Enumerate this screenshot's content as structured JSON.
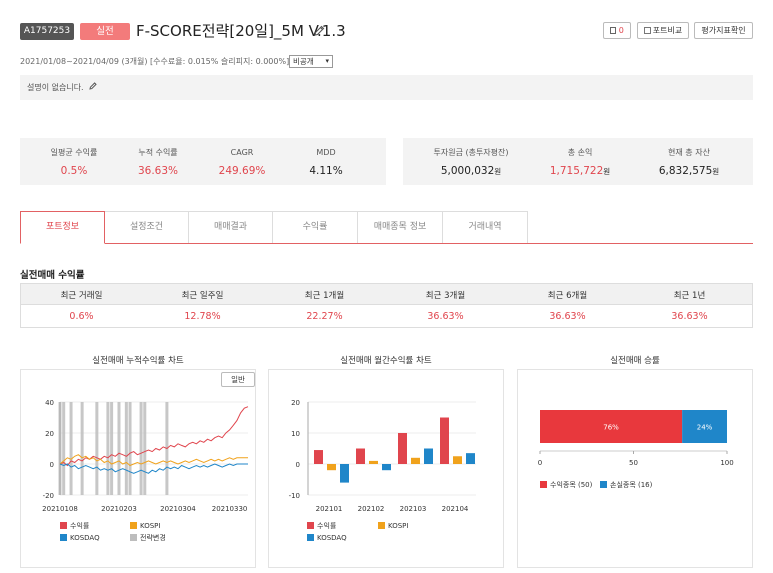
{
  "header": {
    "id": "A1757253",
    "type": "실전",
    "title": "F-SCORE전략[20일]_5M V.1.3",
    "like_count": "0",
    "compare_label": "포트비교",
    "eval_label": "평가지표확인",
    "meta": "2021/01/08~2021/04/09 (3개월) [수수료율: 0.015% 슬리피지: 0.000%]",
    "visibility": "비공개",
    "description": "설명이 없습니다."
  },
  "summary": {
    "left": [
      {
        "label": "일평균 수익률",
        "value": "0.5%"
      },
      {
        "label": "누적 수익률",
        "value": "36.63%"
      },
      {
        "label": "CAGR",
        "value": "249.69%"
      },
      {
        "label": "MDD",
        "value": "4.11%"
      }
    ],
    "right": [
      {
        "label": "투자원금 (총투자평잔)",
        "value": "5,000,032",
        "unit": "원"
      },
      {
        "label": "총 손익",
        "value": "1,715,722",
        "unit": "원"
      },
      {
        "label": "현재 총 자산",
        "value": "6,832,575",
        "unit": "원"
      }
    ]
  },
  "tabs": [
    "포트정보",
    "설정조건",
    "매매결과",
    "수익률",
    "매매종목 정보",
    "거래내역"
  ],
  "returns": {
    "title": "실전매매 수익률",
    "headers": [
      "최근 거래일",
      "최근 일주일",
      "최근 1개월",
      "최근 3개월",
      "최근 6개월",
      "최근 1년"
    ],
    "values": [
      "0.6%",
      "12.78%",
      "22.27%",
      "36.63%",
      "36.63%",
      "36.63%"
    ]
  },
  "colors": {
    "red": "#e0454d",
    "orange": "#f0a21c",
    "blue": "#1f86c9",
    "gray": "#bdbdbd"
  },
  "chart_data": [
    {
      "type": "line",
      "title": "실전매매 누적수익률 차트",
      "mode_button": "일반",
      "x_ticks": [
        "20210108",
        "20210203",
        "20210304",
        "20210330"
      ],
      "ylim": [
        -20,
        40
      ],
      "y_ticks": [
        "40",
        "20",
        "0",
        "-20"
      ],
      "series": [
        {
          "name": "수익률",
          "color": "#e0454d",
          "values": [
            0,
            1,
            -1,
            2,
            1,
            3,
            2,
            4,
            3,
            5,
            4,
            3,
            5,
            4,
            6,
            5,
            7,
            6,
            5,
            7,
            8,
            6,
            7,
            8,
            9,
            8,
            10,
            9,
            11,
            10,
            12,
            11,
            13,
            12,
            11,
            13,
            14,
            13,
            15,
            14,
            16,
            15,
            17,
            18,
            17,
            20,
            22,
            25,
            28,
            33,
            36,
            37
          ]
        },
        {
          "name": "KOSPI",
          "color": "#f0a21c",
          "values": [
            0,
            2,
            4,
            3,
            5,
            6,
            4,
            5,
            3,
            4,
            2,
            3,
            1,
            2,
            0,
            1,
            2,
            0,
            1,
            -1,
            0,
            1,
            0,
            1,
            2,
            1,
            0,
            1,
            2,
            1,
            2,
            1,
            0,
            1,
            2,
            1,
            2,
            3,
            2,
            1,
            2,
            3,
            2,
            3,
            2,
            3,
            4,
            3,
            4,
            4,
            4,
            4
          ]
        },
        {
          "name": "KOSDAQ",
          "color": "#1f86c9",
          "values": [
            0,
            -1,
            0,
            -2,
            -1,
            -3,
            -2,
            -1,
            -2,
            -3,
            -2,
            -4,
            -3,
            -4,
            -3,
            -5,
            -4,
            -3,
            -4,
            -5,
            -6,
            -5,
            -4,
            -5,
            -6,
            -4,
            -5,
            -3,
            -4,
            -2,
            -3,
            -2,
            -3,
            -1,
            -2,
            -3,
            -2,
            -1,
            -2,
            -1,
            -2,
            -1,
            0,
            -1,
            -2,
            -1,
            0,
            -1,
            0,
            0,
            0,
            0
          ]
        }
      ],
      "markers_label": "전략변경",
      "marker_positions": [
        0,
        1,
        3,
        6,
        10,
        13,
        14,
        16,
        18,
        19,
        22,
        23,
        29
      ]
    },
    {
      "type": "bar",
      "title": "실전매매 월간수익률 차트",
      "categories": [
        "202101",
        "202102",
        "202103",
        "202104"
      ],
      "ylim": [
        -10,
        20
      ],
      "y_ticks": [
        "20",
        "10",
        "0",
        "-10"
      ],
      "series": [
        {
          "name": "수익률",
          "color": "#e0454d",
          "values": [
            4.5,
            5,
            10,
            15
          ]
        },
        {
          "name": "KOSPI",
          "color": "#f0a21c",
          "values": [
            -2,
            1,
            2,
            2.5
          ]
        },
        {
          "name": "KOSDAQ",
          "color": "#1f86c9",
          "values": [
            -6,
            -2,
            5,
            3.5
          ]
        }
      ]
    },
    {
      "type": "bar",
      "title": "실전매매 승률",
      "x_ticks": [
        "0",
        "50",
        "100"
      ],
      "xlim": [
        0,
        100
      ],
      "series": [
        {
          "name": "수익종목 (50)",
          "color": "#e8383d",
          "value": 76,
          "label": "76%"
        },
        {
          "name": "손실종목 (16)",
          "color": "#1f86c9",
          "value": 24,
          "label": "24%"
        }
      ]
    }
  ]
}
